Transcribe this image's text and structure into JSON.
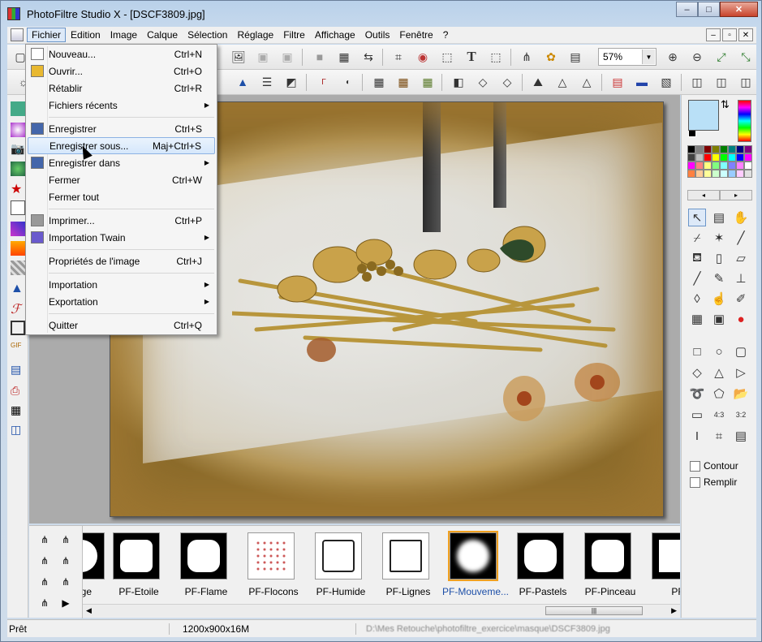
{
  "window": {
    "title": "PhotoFiltre Studio X - [DSCF3809.jpg]",
    "min_label": "–",
    "max_label": "□",
    "close_label": "✕"
  },
  "menubar": {
    "items": [
      "Fichier",
      "Edition",
      "Image",
      "Calque",
      "Sélection",
      "Réglage",
      "Filtre",
      "Affichage",
      "Outils",
      "Fenêtre",
      "?"
    ],
    "active": "Fichier",
    "mdi": [
      "–",
      "▫",
      "✕"
    ]
  },
  "toolbar": {
    "zoom_value": "57%",
    "text_tool": "T"
  },
  "file_menu": {
    "items": [
      {
        "label": "Nouveau...",
        "shortcut": "Ctrl+N",
        "submenu": false
      },
      {
        "label": "Ouvrir...",
        "shortcut": "Ctrl+O",
        "submenu": false
      },
      {
        "label": "Rétablir",
        "shortcut": "Ctrl+R",
        "submenu": false
      },
      {
        "label": "Fichiers récents",
        "shortcut": "",
        "submenu": true
      },
      {
        "label": "Enregistrer",
        "shortcut": "Ctrl+S",
        "submenu": false
      },
      {
        "label": "Enregistrer sous...",
        "shortcut": "Maj+Ctrl+S",
        "submenu": false
      },
      {
        "label": "Enregistrer dans",
        "shortcut": "",
        "submenu": true
      },
      {
        "label": "Fermer",
        "shortcut": "Ctrl+W",
        "submenu": false
      },
      {
        "label": "Fermer tout",
        "shortcut": "",
        "submenu": false
      },
      {
        "label": "Imprimer...",
        "shortcut": "Ctrl+P",
        "submenu": false
      },
      {
        "label": "Importation Twain",
        "shortcut": "",
        "submenu": true
      },
      {
        "label": "Propriétés de l'image",
        "shortcut": "Ctrl+J",
        "submenu": false
      },
      {
        "label": "Importation",
        "shortcut": "",
        "submenu": true
      },
      {
        "label": "Exportation",
        "shortcut": "",
        "submenu": true
      },
      {
        "label": "Quitter",
        "shortcut": "Ctrl+Q",
        "submenu": false
      }
    ],
    "highlighted": "Enregistrer sous..."
  },
  "right_panel": {
    "foreground_color": "#b9e0f7",
    "background_color": "#000000",
    "contour_label": "Contour",
    "remplir_label": "Remplir",
    "palette": [
      "#000000",
      "#808080",
      "#800000",
      "#808000",
      "#008000",
      "#008080",
      "#000080",
      "#800080",
      "#404040",
      "#c0c0c0",
      "#ff0000",
      "#ffff00",
      "#00ff00",
      "#00ffff",
      "#0000ff",
      "#ff00ff",
      "#ff00ff",
      "#ff8080",
      "#ffff80",
      "#80ff80",
      "#80ffff",
      "#8080ff",
      "#ff80ff",
      "#ffffff",
      "#ff8040",
      "#ffcc99",
      "#ffff99",
      "#ccffcc",
      "#ccffff",
      "#99ccff",
      "#ffccff",
      "#e0e0e0"
    ]
  },
  "filmstrip": {
    "items": [
      "nge",
      "PF-Etoile",
      "PF-Flame",
      "PF-Flocons",
      "PF-Humide",
      "PF-Lignes",
      "PF-Mouveme...",
      "PF-Pastels",
      "PF-Pinceau",
      "PF"
    ],
    "selected": "PF-Mouveme...",
    "scroll_grip": "|||"
  },
  "statusbar": {
    "state": "Prêt",
    "image_size": "1200x900x16M",
    "path": "D:\\Mes Retouche\\photofiltre_exercice\\masque\\DSCF3809.jpg"
  }
}
